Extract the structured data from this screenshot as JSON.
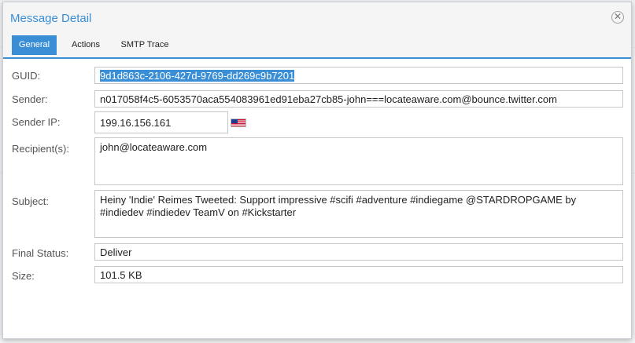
{
  "dialog": {
    "title": "Message Detail",
    "close_icon": "close-icon"
  },
  "tabs": [
    {
      "label": "General",
      "active": true
    },
    {
      "label": "Actions",
      "active": false
    },
    {
      "label": "SMTP Trace",
      "active": false
    }
  ],
  "general": {
    "guid": {
      "label": "GUID:",
      "value": "9d1d863c-2106-427d-9769-dd269c9b7201",
      "selected": true
    },
    "sender": {
      "label": "Sender:",
      "value": "n017058f4c5-6053570aca554083961ed91eba27cb85-john===locateaware.com@bounce.twitter.com"
    },
    "sender_ip": {
      "label": "Sender IP:",
      "value": "199.16.156.161",
      "flag": "us-flag-icon"
    },
    "recipients": {
      "label": "Recipient(s):",
      "value": "john@locateaware.com"
    },
    "subject": {
      "label": "Subject:",
      "value": "Heiny 'Indie' Reimes Tweeted: Support impressive #scifi #adventure #indiegame @STARDROPGAME by #indiedev #indiedev TeamV on #Kickstarter"
    },
    "final_status": {
      "label": "Final Status:",
      "value": "Deliver"
    },
    "size": {
      "label": "Size:",
      "value": "101.5 KB"
    }
  },
  "colors": {
    "accent": "#3a8ed6",
    "title": "#3a8ed6"
  }
}
